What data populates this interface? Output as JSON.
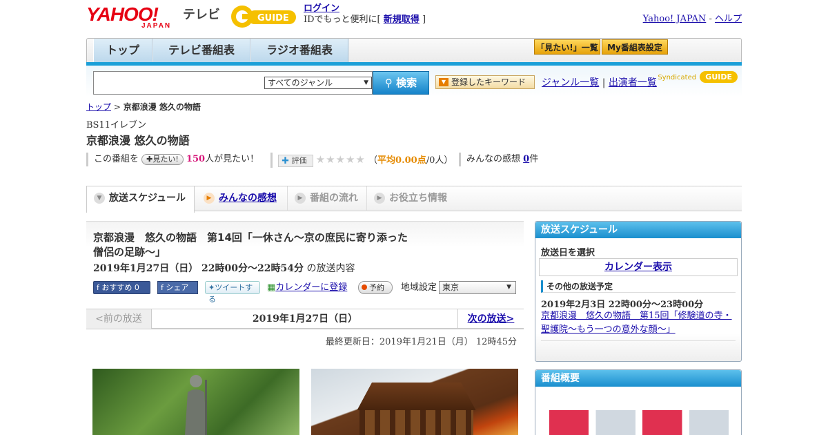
{
  "header": {
    "logo_yahoo": "YAHOO!",
    "logo_japan": "JAPAN",
    "tv_label": "テレビ",
    "gguide_label": "GUIDE",
    "login_link": "ログイン",
    "login_text": "IDでもっと便利に[",
    "signup_link": "新規取得",
    "login_close": "]",
    "yahoo_japan_link": "Yahoo! JAPAN",
    "separator": "-",
    "help_link": "ヘルプ"
  },
  "nav": {
    "tabs": [
      "トップ",
      "テレビ番組表",
      "ラジオ番組表"
    ],
    "mitai_list": "「見たい!」一覧",
    "my_bangumi": "My番組表設定"
  },
  "search": {
    "genre_select": "すべてのジャンル",
    "search_button": "検索",
    "keyword_button": "登録したキーワード",
    "genre_list_link": "ジャンル一覧",
    "divider": "|",
    "performer_list_link": "出演者一覧",
    "syndicated": "Syndicated",
    "syndicated_logo": "GUIDE"
  },
  "breadcrumb": {
    "top": "トップ",
    "sep": ">",
    "current": "京都浪漫 悠久の物語"
  },
  "program": {
    "channel": "BS11イレブン",
    "title": "京都浪漫 悠久の物語",
    "this_program": "この番組を",
    "mitai_button": "見たい!",
    "mitai_count": "150",
    "mitai_suffix": "人が見たい！",
    "rating_button": "評価",
    "stars": "★★★★★",
    "avg_open": "（",
    "avg_label": "平均0.00点",
    "avg_count": "/0人",
    "avg_close": "）",
    "impressions_label": "みんなの感想",
    "impressions_count": "0",
    "impressions_suffix": "件"
  },
  "tabs": [
    {
      "label": "放送スケジュール",
      "icon": "▼"
    },
    {
      "label": "みんなの感想",
      "icon": "▶"
    },
    {
      "label": "番組の流れ",
      "icon": "▶"
    },
    {
      "label": "お役立ち情報",
      "icon": "▶"
    }
  ],
  "episode": {
    "title": "京都浪漫　悠久の物語　第14回「一休さん～京の庶民に寄り添った僧侶の足跡～」",
    "datetime": "2019年1月27日（日）  22時00分～22時54分",
    "datetime_suffix": "の放送内容",
    "fb_recommend": "おすすめ 0",
    "fb_share": "シェア",
    "tweet": "ツイートする",
    "calendar_register": "カレンダーに登録",
    "reserve": "予約",
    "region_label": "地域設定",
    "region_value": "東京"
  },
  "episode_nav": {
    "prev": "<前の放送",
    "current": "2019年1月27日（日）",
    "next": "次の放送>"
  },
  "updated": "最終更新日：2019年1月21日（月）  12時45分",
  "sidebar": {
    "schedule_head": "放送スケジュール",
    "pick_date": "放送日を選択",
    "calendar_button": "カレンダー表示",
    "other_head": "その他の放送予定",
    "other_date": "2019年2月3日  22時00分～23時00分",
    "other_link": "京都浪漫　悠久の物語　第15回「修験道の寺・聖護院～もう一つの意外な顔～」",
    "overview_head": "番組概要"
  },
  "colors": {
    "accent_blue": "#1a9fd8",
    "link": "#1a0dab",
    "yahoo_red": "#e60012",
    "pink_count": "#d6177a",
    "orange_avg": "#e58a00"
  }
}
